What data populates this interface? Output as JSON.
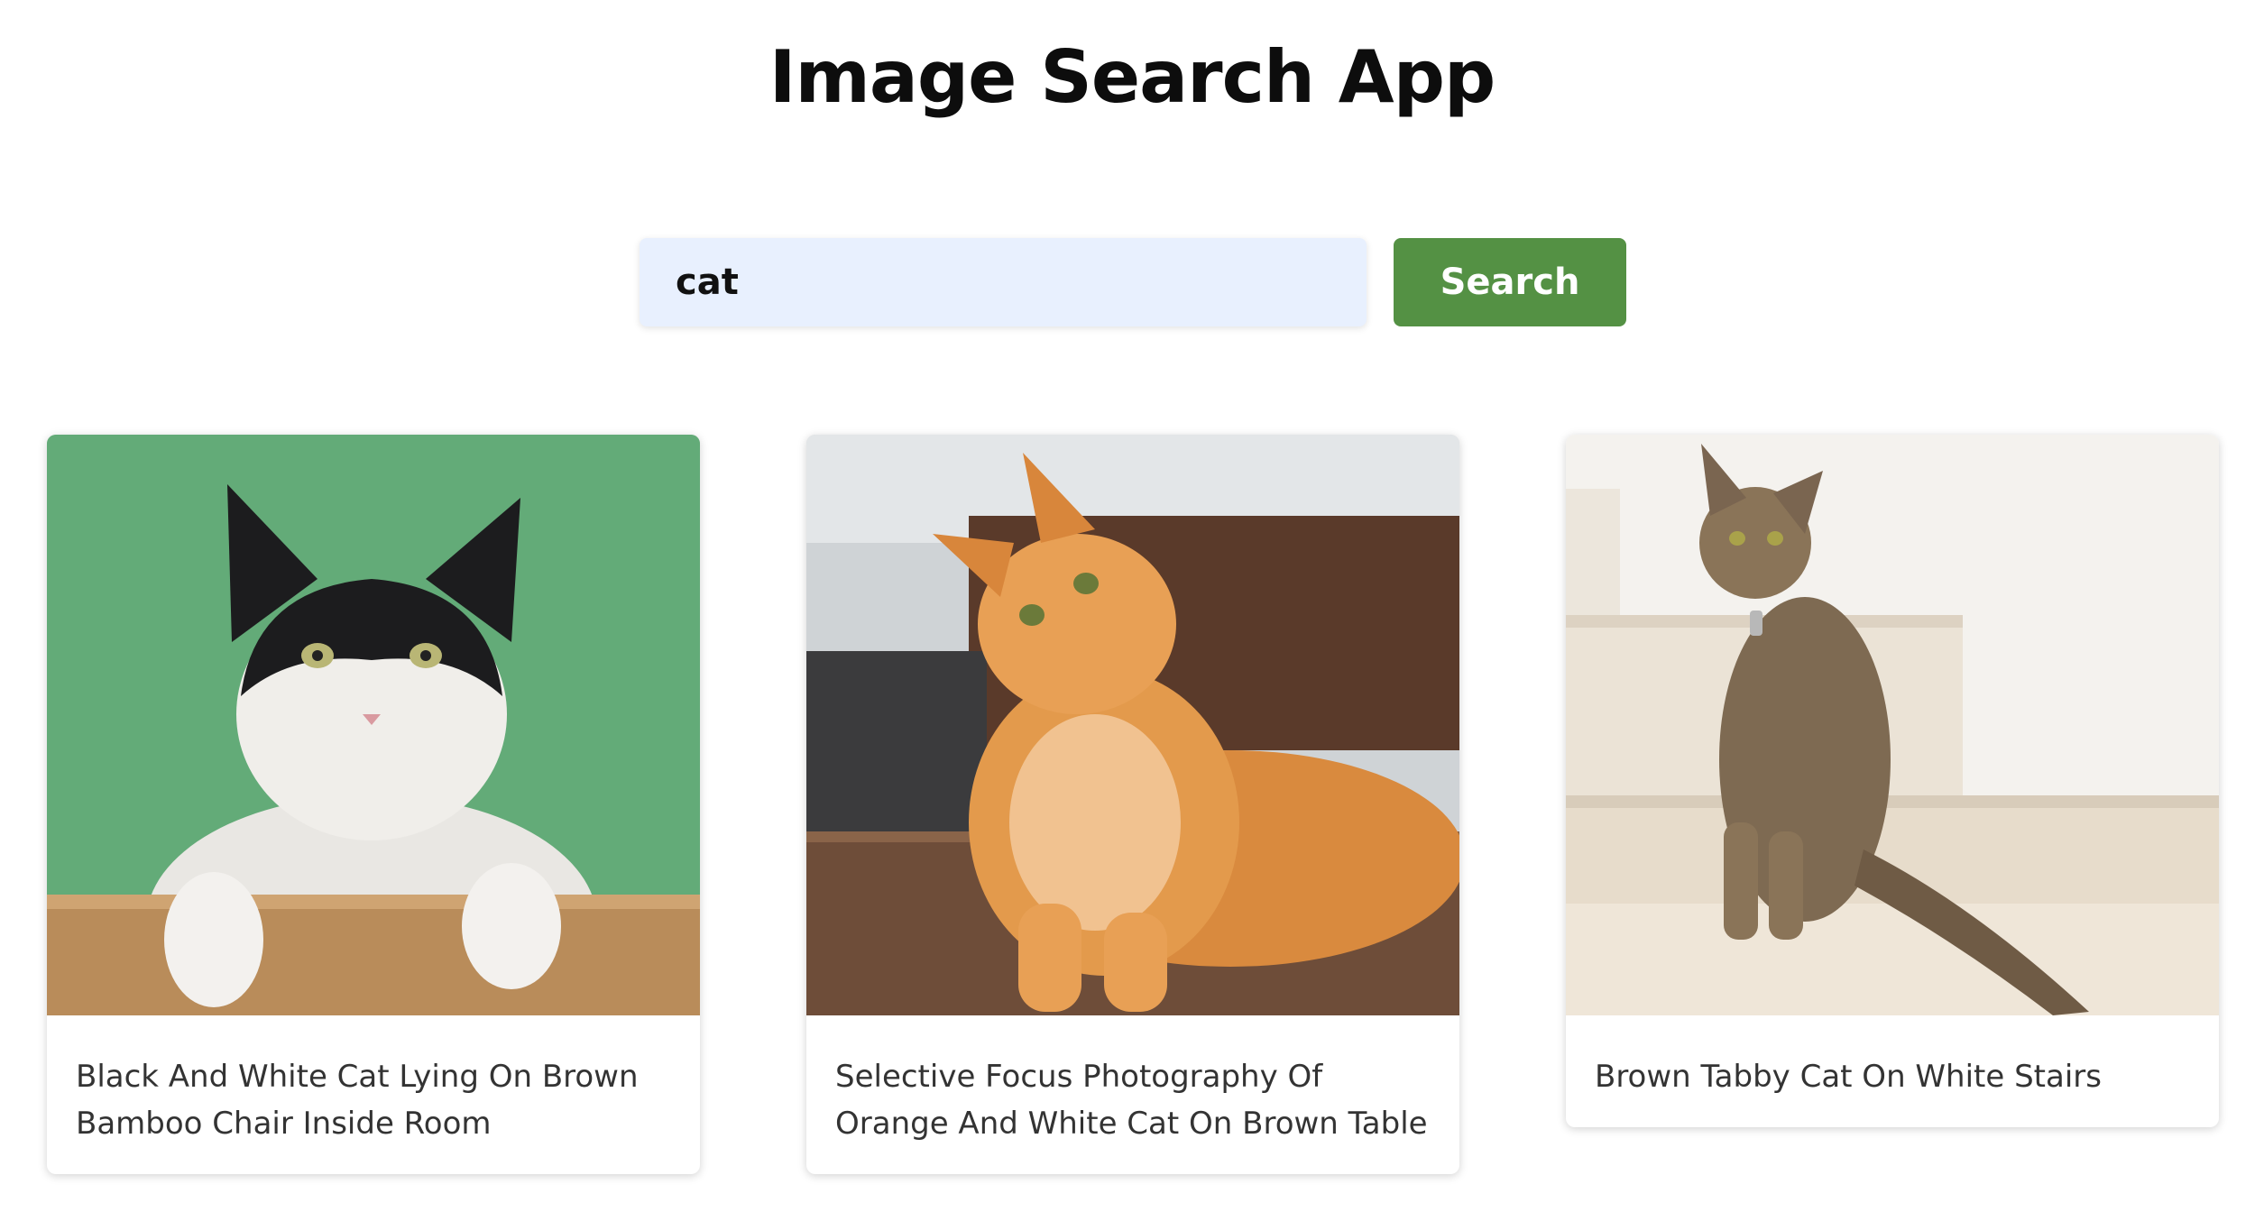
{
  "header": {
    "title": "Image Search App"
  },
  "search": {
    "value": "cat",
    "button_label": "Search"
  },
  "results": [
    {
      "caption": "Black And White Cat Lying On Brown Bamboo Chair Inside Room"
    },
    {
      "caption": "Selective Focus Photography Of Orange And White Cat On Brown Table"
    },
    {
      "caption": "Brown Tabby Cat On White Stairs"
    }
  ],
  "colors": {
    "accent": "#549144",
    "input_background": "#e8f0fe"
  }
}
